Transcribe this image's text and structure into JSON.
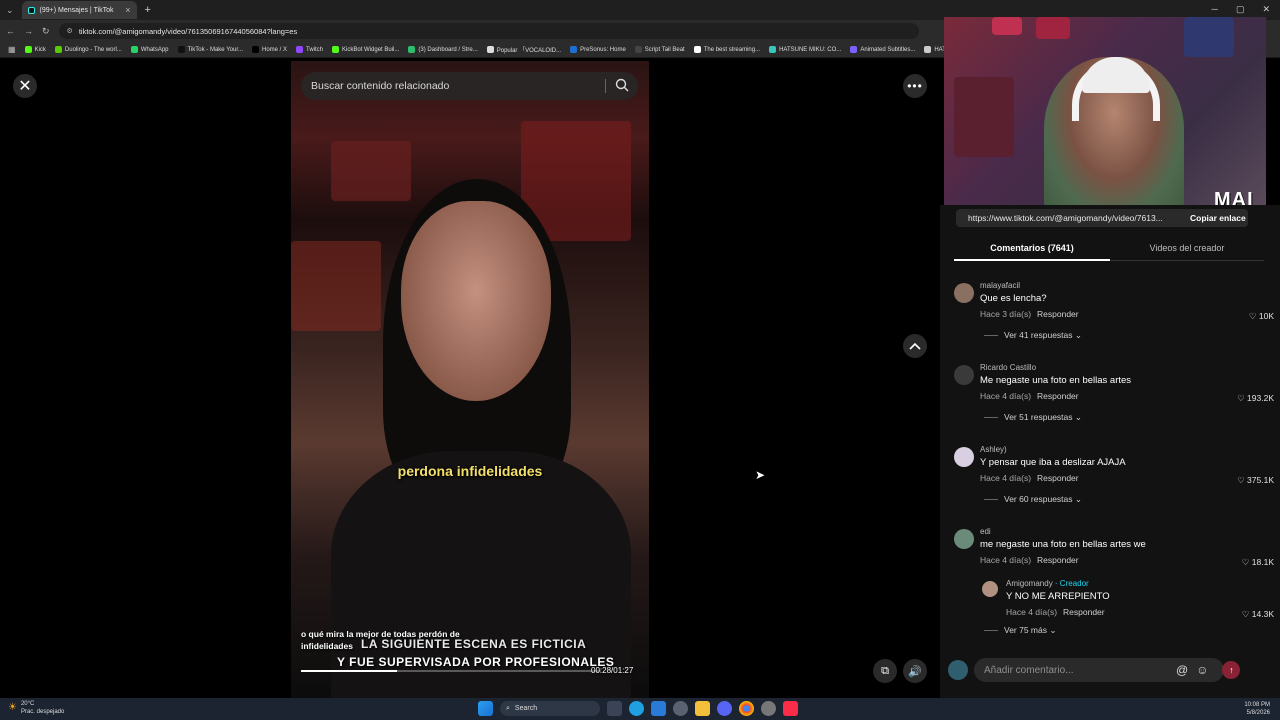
{
  "browser": {
    "tab_title": "(99+) Mensajes | TikTok",
    "tab_close": "×",
    "new_tab": "+",
    "url": "tiktok.com/@amigomandy/video/7613506916744056084?lang=es",
    "bookmarks": [
      {
        "label": "Kick",
        "color": "#53fc18"
      },
      {
        "label": "Duolingo - The worl...",
        "color": "#58cc02"
      },
      {
        "label": "WhatsApp",
        "color": "#25d366"
      },
      {
        "label": "TikTok - Make Your...",
        "color": "#111111"
      },
      {
        "label": "Home / X",
        "color": "#000000"
      },
      {
        "label": "Twitch",
        "color": "#9146ff"
      },
      {
        "label": "KickBot Widget Buil...",
        "color": "#53fc18"
      },
      {
        "label": "(3) Dashboard / Stre...",
        "color": "#2dbd6e"
      },
      {
        "label": "Popular 「VOCALOID...",
        "color": "#dddddd"
      },
      {
        "label": "PreSonus: Home",
        "color": "#1d6fd1"
      },
      {
        "label": "Script Tail Beat",
        "color": "#444444"
      },
      {
        "label": "The best streaming...",
        "color": "#ffffff"
      },
      {
        "label": "HATSUNE MIKU: CO...",
        "color": "#39c5bb"
      },
      {
        "label": "Animated Subtitles...",
        "color": "#7b61ff"
      },
      {
        "label": "HAT",
        "color": "#cccccc"
      }
    ]
  },
  "video": {
    "search_placeholder": "Buscar contenido relacionado",
    "caption_mid": "perdona infidelidades",
    "caption_small_1": "o qué mira la mejor de todas perdón de",
    "caption_small_2": "infidelidades",
    "warning_1": "LA SIGUIENTE ESCENA ES FICTICIA",
    "warning_2": "Y FUE SUPERVISADA POR PROFESIONALES",
    "time": "00:28/01:27",
    "progress": 0.32
  },
  "webcam": {
    "logo": "MAI"
  },
  "panel": {
    "link": "https://www.tiktok.com/@amigomandy/video/7613...",
    "copy_label": "Copiar enlace",
    "tab_comments": "Comentarios (7641)",
    "tab_videos": "Videos del creador",
    "comments": [
      {
        "name": "malayafacil",
        "text": "Que es lencha?",
        "time": "Hace 3 día(s)",
        "reply": "Responder",
        "likes": "♡ 10K",
        "more": "Ver 41 respuestas ⌄"
      },
      {
        "name": "Ricardo Castillo",
        "text": "Me negaste una foto en bellas artes",
        "time": "Hace 4 día(s)",
        "reply": "Responder",
        "likes": "♡ 193.2K",
        "more": "Ver 51 respuestas ⌄"
      },
      {
        "name": "Ashley)",
        "text": "Y pensar que iba a deslizar AJAJA",
        "time": "Hace 4 día(s)",
        "reply": "Responder",
        "likes": "♡ 375.1K",
        "more": "Ver 60 respuestas ⌄"
      },
      {
        "name": "edi",
        "text": "me negaste una foto en bellas artes we",
        "time": "Hace 4 día(s)",
        "reply": "Responder",
        "likes": "♡ 18.1K",
        "more": ""
      }
    ],
    "reply": {
      "name": "Amigomandy",
      "creator": "· Creador",
      "text": "Y NO ME ARREPIENTO",
      "time": "Hace 4 día(s)",
      "reply": "Responder",
      "likes": "♡ 14.3K",
      "more": "Ver 75 más ⌄"
    },
    "comment_placeholder": "Añadir comentario...",
    "at": "@",
    "emoji": "☺",
    "send": "↑"
  },
  "taskbar": {
    "temp": "20°C",
    "weather": "Prac. despejado",
    "search": "Search",
    "time": "10:08 PM",
    "date": "5/8/2026"
  }
}
